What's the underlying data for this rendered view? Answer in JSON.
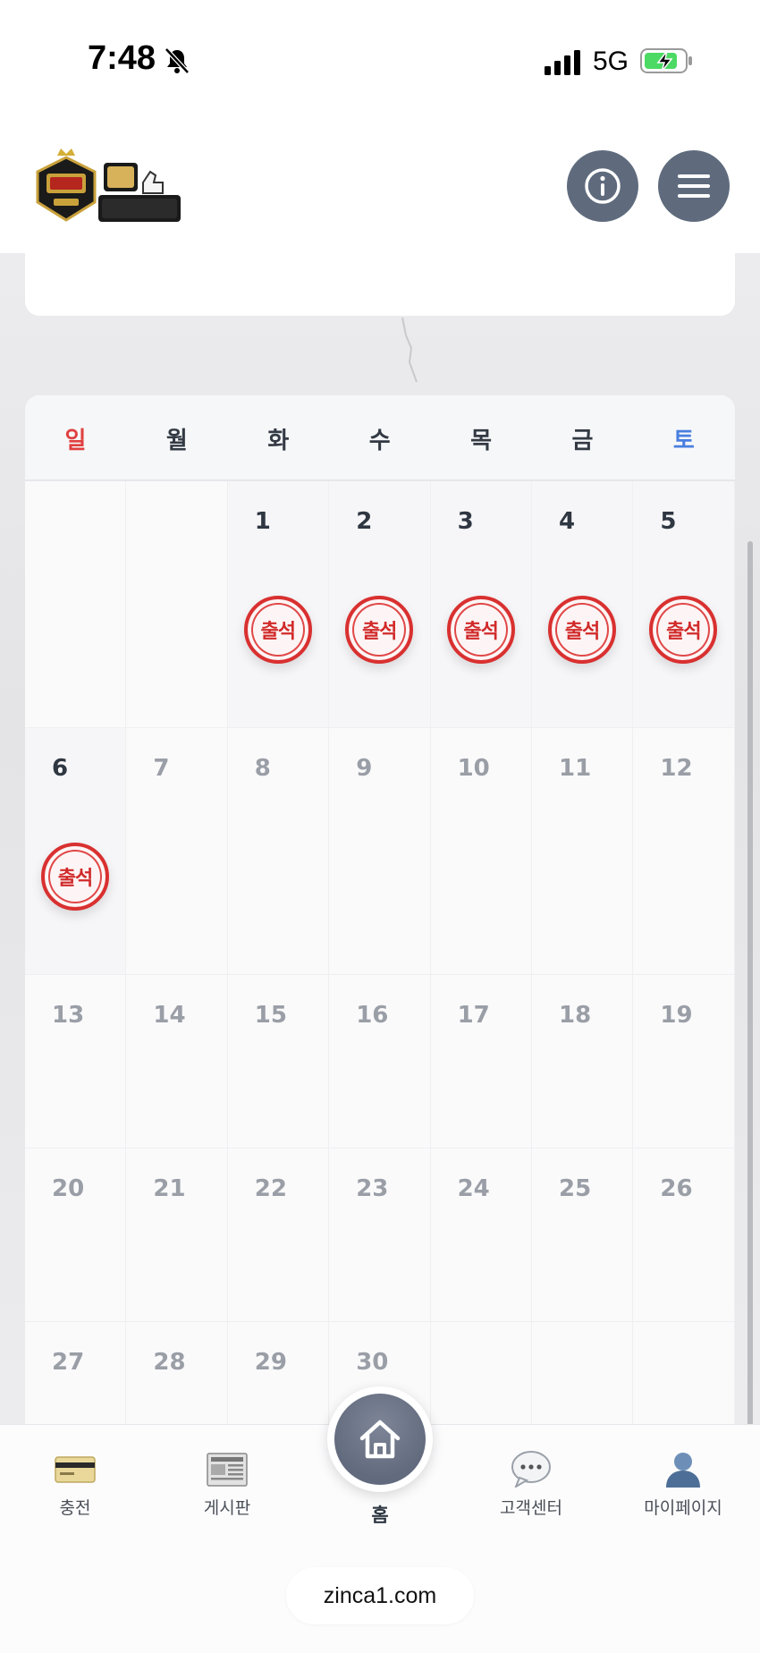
{
  "status_bar": {
    "time": "7:48",
    "network": "5G"
  },
  "header": {
    "logo_alt": "찐! 카지노",
    "info_icon": "info-icon",
    "menu_icon": "hamburger-menu-icon"
  },
  "calendar": {
    "weekdays": [
      "일",
      "월",
      "화",
      "수",
      "목",
      "금",
      "토"
    ],
    "stamp_label": "출석",
    "weeks": [
      [
        "",
        "",
        "1",
        "2",
        "3",
        "4",
        "5"
      ],
      [
        "6",
        "7",
        "8",
        "9",
        "10",
        "11",
        "12"
      ],
      [
        "13",
        "14",
        "15",
        "16",
        "17",
        "18",
        "19"
      ],
      [
        "20",
        "21",
        "22",
        "23",
        "24",
        "25",
        "26"
      ],
      [
        "27",
        "28",
        "29",
        "30",
        "",
        "",
        ""
      ]
    ],
    "stamped_days": [
      "1",
      "2",
      "3",
      "4",
      "5",
      "6"
    ],
    "active_days": [
      "1",
      "2",
      "3",
      "4",
      "5",
      "6"
    ],
    "colors": {
      "sunday": "#e04040",
      "saturday": "#4a7fe0",
      "stamp": "#d12a2a"
    }
  },
  "tabbar": {
    "items": [
      {
        "label": "충전",
        "icon": "credit-card-icon"
      },
      {
        "label": "게시판",
        "icon": "newspaper-icon"
      },
      {
        "label": "홈",
        "icon": "home-icon"
      },
      {
        "label": "고객센터",
        "icon": "chat-bubble-icon"
      },
      {
        "label": "마이페이지",
        "icon": "user-icon"
      }
    ]
  },
  "browser": {
    "url": "zinca1.com"
  }
}
